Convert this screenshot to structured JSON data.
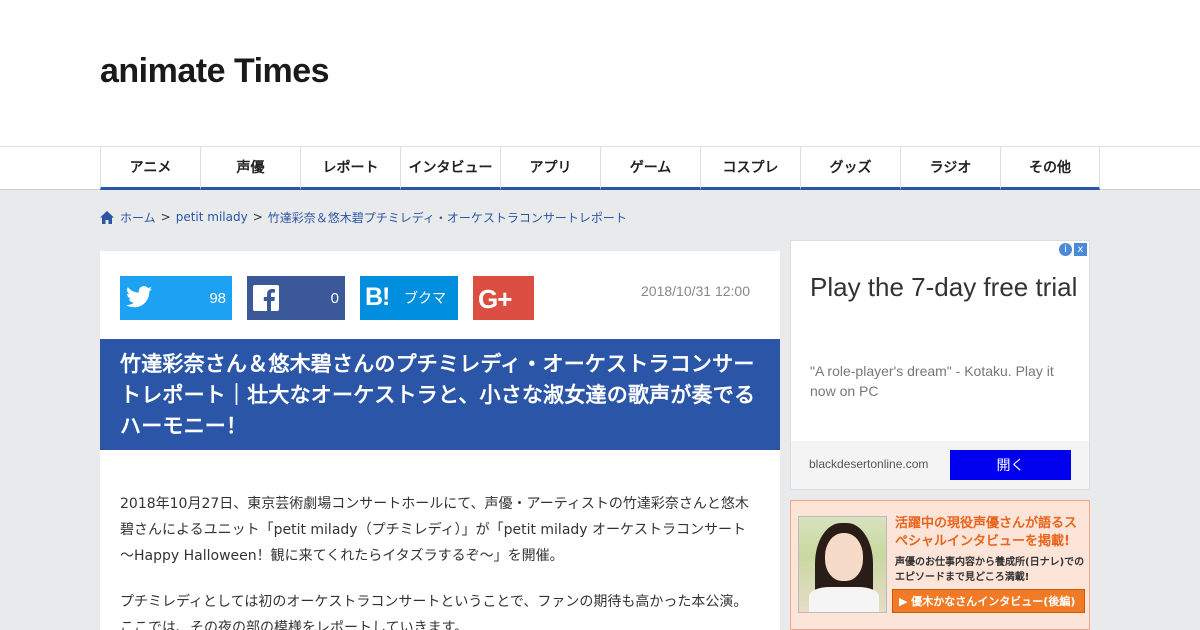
{
  "header": {
    "logo_text": "animate Times"
  },
  "nav": {
    "items": [
      "アニメ",
      "声優",
      "レポート",
      "インタビュー",
      "アプリ",
      "ゲーム",
      "コスプレ",
      "グッズ",
      "ラジオ",
      "その他"
    ]
  },
  "breadcrumb": {
    "home": "ホーム",
    "separator": ">",
    "category": "petit milady",
    "current": "竹達彩奈＆悠木碧プチミレディ・オーケストラコンサートレポート"
  },
  "share": {
    "twitter_count": "98",
    "facebook_count": "0",
    "hatena_icon": "B!",
    "hatena_label": "ブクマ",
    "google_label": "G+"
  },
  "article": {
    "date": "2018/10/31 12:00",
    "title": "竹達彩奈さん＆悠木碧さんのプチミレディ・オーケストラコンサートレポート｜壮大なオーケストラと、小さな淑女達の歌声が奏でるハーモニー！",
    "paragraphs": [
      "2018年10月27日、東京芸術劇場コンサートホールにて、声優・アーティストの竹達彩奈さんと悠木碧さんによるユニット「petit milady（プチミレディ）」が「petit milady オーケストラコンサート～Happy Halloween！観に来てくれたらイタズラするぞ～」を開催。",
      "プチミレディとしては初のオーケストラコンサートということで、ファンの期待も高かった本公演。ここでは、その夜の部の模様をレポートしていきます。"
    ]
  },
  "ad": {
    "headline": "Play the 7-day free trial",
    "description": "\"A role-player's dream\" - Kotaku. Play it now on PC",
    "domain": "blackdesertonline.com",
    "button": "開く",
    "choices_icon": "i",
    "close_icon": "x"
  },
  "banner": {
    "headline": "活躍中の現役声優さんが語るスペシャルインタビューを掲載!",
    "sub": "声優のお仕事内容から養成所(日ナレ)でのエピソードまで見どころ満載!",
    "button": "▶ 優木かなさんインタビュー(後編)"
  },
  "colors": {
    "brand_blue": "#2b56a8",
    "twitter": "#1da1f2",
    "facebook": "#3b5998",
    "hatena": "#008fde",
    "google_plus": "#dc4e41",
    "logo_dot": "#f5b80a"
  }
}
